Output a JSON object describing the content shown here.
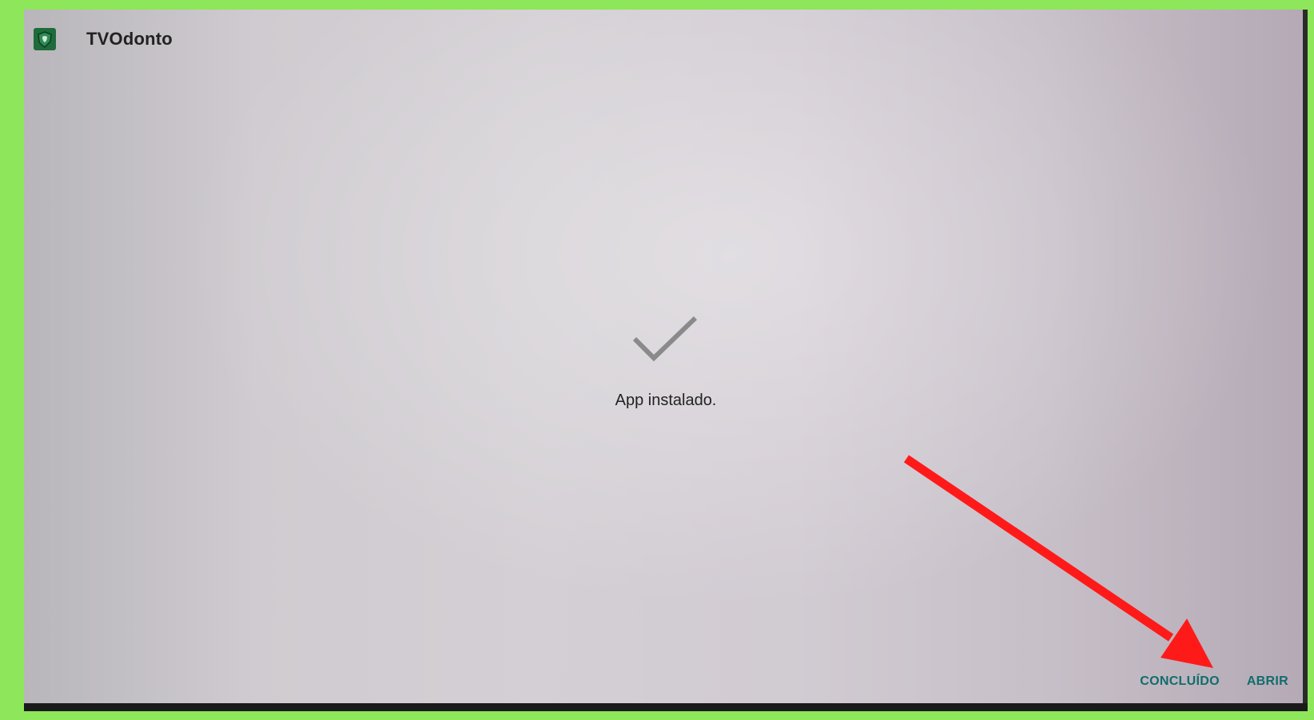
{
  "app": {
    "title": "TVOdonto",
    "icon": "tvodonto-app-icon"
  },
  "status": {
    "icon": "checkmark-icon",
    "message": "App instalado."
  },
  "actions": {
    "done_label": "CONCLUÍDO",
    "open_label": "ABRIR"
  },
  "annotation": {
    "icon": "red-arrow-icon",
    "color": "#ff1a1a"
  },
  "colors": {
    "frame_border": "#8ee65a",
    "accent": "#116d6b"
  }
}
